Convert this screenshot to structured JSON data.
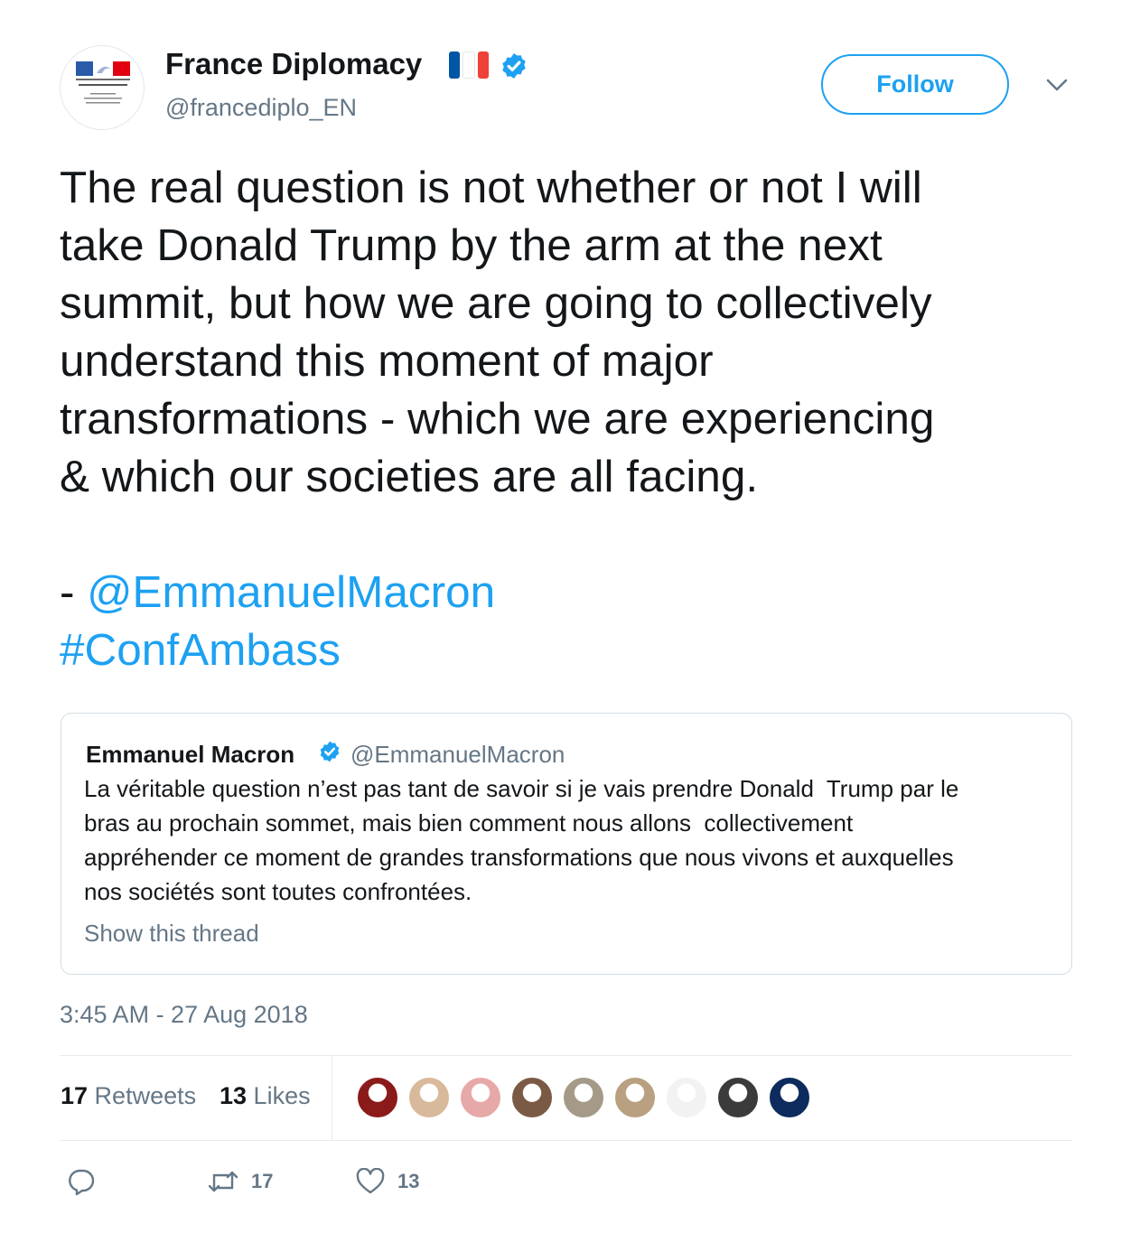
{
  "account": {
    "display_name": "France Diplomacy",
    "handle": "@francediplo_EN",
    "avatar": "ministry-logo",
    "flag_colors": [
      "#0055a4",
      "#ffffff",
      "#ef4135"
    ],
    "verified_icon": "verified-badge-icon",
    "follow_label": "Follow",
    "more_icon": "chevron-down-icon"
  },
  "tweet": {
    "lines": [
      "The real question is not whether or not I will",
      "take Donald Trump by the arm at the next",
      "summit, but how we are going to collectively",
      "understand this moment of major",
      "transformations - which we are experiencing",
      "& which our societies are all facing."
    ],
    "sig_prefix": "- ",
    "mention": "@EmmanuelMacron",
    "hashtag": "#ConfAmbass"
  },
  "quote": {
    "name": "Emmanuel Macron",
    "handle": "@EmmanuelMacron",
    "lines": [
      "La véritable question n’est pas tant de savoir si je vais prendre Donald  Trump par le",
      "bras au prochain sommet, mais bien comment nous allons  collectivement",
      "appréhender ce moment de grandes transformations que nous vivons et auxquelles",
      "nos sociétés sont toutes confrontées."
    ],
    "show_thread": "Show this thread"
  },
  "timestamp": "3:45 AM - 27 Aug 2018",
  "stats": {
    "retweets_count": "17",
    "retweets_label": " Retweets",
    "likes_count": "13",
    "likes_label": " Likes"
  },
  "liked_by": [
    {
      "name": "avatar-1",
      "color": "#8b1a1a"
    },
    {
      "name": "avatar-2",
      "color": "#d9b99b"
    },
    {
      "name": "avatar-3",
      "color": "#e7a8a8"
    },
    {
      "name": "avatar-4",
      "color": "#7a5a44"
    },
    {
      "name": "avatar-5",
      "color": "#a59a88"
    },
    {
      "name": "avatar-6",
      "color": "#b8a080"
    },
    {
      "name": "avatar-7",
      "color": "#f2f2f2"
    },
    {
      "name": "avatar-8",
      "color": "#3b3b3b"
    },
    {
      "name": "avatar-9",
      "color": "#0d2b5c"
    }
  ],
  "actions": {
    "reply_icon": "reply-icon",
    "retweet_icon": "retweet-icon",
    "retweet_count": "17",
    "like_icon": "heart-icon",
    "like_count": "13",
    "accent": "#1da1f2",
    "muted": "#657786"
  }
}
